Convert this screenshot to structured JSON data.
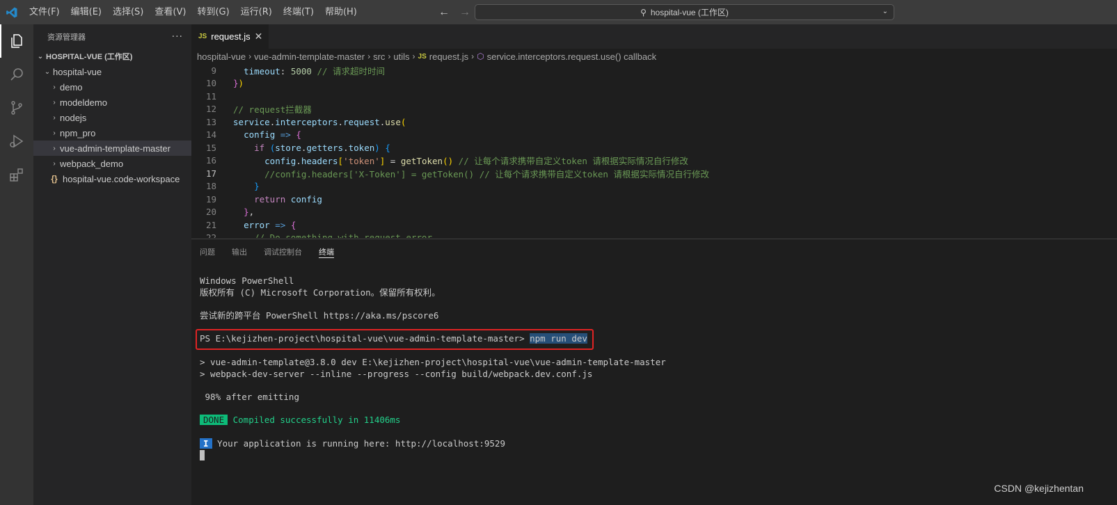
{
  "menubar": {
    "items": [
      "文件(F)",
      "编辑(E)",
      "选择(S)",
      "查看(V)",
      "转到(G)",
      "运行(R)",
      "终端(T)",
      "帮助(H)"
    ]
  },
  "command_center": {
    "label": "hospital-vue (工作区)"
  },
  "sidebar": {
    "title": "资源管理器",
    "workspace": "HOSPITAL-VUE (工作区)",
    "root": "hospital-vue",
    "items": [
      {
        "label": "demo",
        "type": "folder"
      },
      {
        "label": "modeldemo",
        "type": "folder"
      },
      {
        "label": "nodejs",
        "type": "folder"
      },
      {
        "label": "npm_pro",
        "type": "folder"
      },
      {
        "label": "vue-admin-template-master",
        "type": "folder",
        "selected": true
      },
      {
        "label": "webpack_demo",
        "type": "folder"
      }
    ],
    "workspace_file": "hospital-vue.code-workspace"
  },
  "editor": {
    "tab": {
      "badge": "JS",
      "label": "request.js"
    },
    "breadcrumbs": [
      "hospital-vue",
      "vue-admin-template-master",
      "src",
      "utils",
      "request.js",
      "service.interceptors.request.use() callback"
    ],
    "line_numbers": [
      "9",
      "10",
      "11",
      "12",
      "13",
      "14",
      "15",
      "16",
      "17",
      "18",
      "19",
      "20",
      "21",
      "22"
    ],
    "current_line": "17"
  },
  "panel": {
    "tabs": [
      "问题",
      "输出",
      "调试控制台",
      "终端"
    ],
    "active_tab": "终端",
    "terminal": {
      "line1": "Windows PowerShell",
      "line2": "版权所有 (C) Microsoft Corporation。保留所有权利。",
      "line3": "尝试新的跨平台 PowerShell https://aka.ms/pscore6",
      "prompt": "PS E:\\kejizhen-project\\hospital-vue\\vue-admin-template-master> ",
      "command": "npm run dev",
      "out1": "> vue-admin-template@3.8.0 dev E:\\kejizhen-project\\hospital-vue\\vue-admin-template-master",
      "out2": "> webpack-dev-server --inline --progress --config build/webpack.dev.conf.js",
      "progress": " 98% after emitting",
      "done_badge": "DONE",
      "done_text": " Compiled successfully in 11406ms",
      "info_badge": "I",
      "info_text": " Your application is running here: http://localhost:9529"
    }
  },
  "watermark": "CSDN @kejizhentan"
}
